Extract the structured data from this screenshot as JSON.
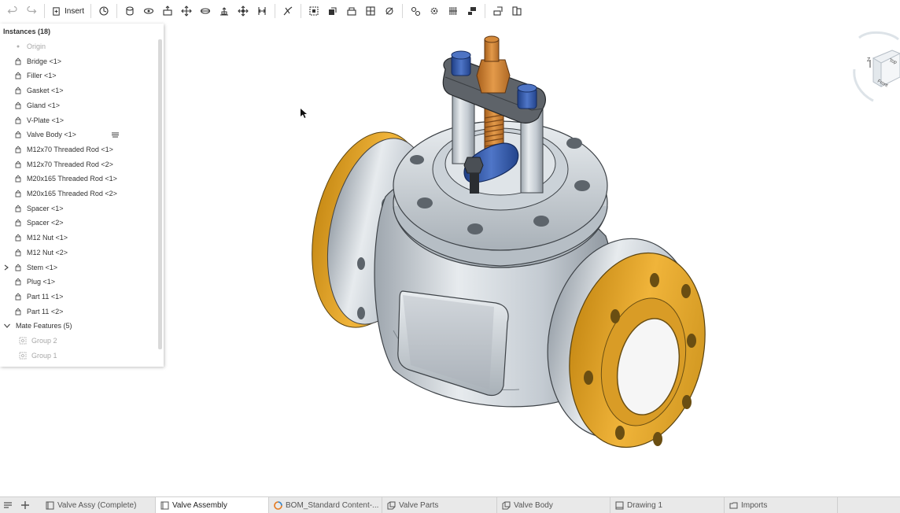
{
  "toolbar": {
    "insert_label": "Insert",
    "tools": [
      "undo-icon",
      "redo-icon",
      "insert-icon",
      "mate-connector-icon",
      "fastened-mate-icon",
      "revolute-mate-icon",
      "slider-mate-icon",
      "planar-mate-icon",
      "cylindrical-mate-icon",
      "pin-slot-mate-icon",
      "ball-mate-icon",
      "parallel-mate-icon",
      "tangent-mate-icon",
      "linear-pattern-icon",
      "circular-pattern-icon",
      "replicate-icon",
      "group-icon",
      "mate-connector-2-icon",
      "relations-icon",
      "gear-relation-icon",
      "rack-pinion-icon",
      "screw-relation-icon",
      "explode-icon",
      "display-states-icon"
    ]
  },
  "panel": {
    "title": "Instances (18)",
    "items": [
      {
        "label": "Origin",
        "type": "origin",
        "dim": true
      },
      {
        "label": "Bridge <1>",
        "type": "part"
      },
      {
        "label": "Filler <1>",
        "type": "part"
      },
      {
        "label": "Gasket <1>",
        "type": "part"
      },
      {
        "label": "Gland <1>",
        "type": "part"
      },
      {
        "label": "V-Plate <1>",
        "type": "part"
      },
      {
        "label": "Valve Body <1>",
        "type": "part"
      },
      {
        "label": "M12x70 Threaded Rod <1>",
        "type": "part"
      },
      {
        "label": "M12x70 Threaded Rod <2>",
        "type": "part"
      },
      {
        "label": "M20x165 Threaded Rod <1>",
        "type": "part"
      },
      {
        "label": "M20x165 Threaded Rod <2>",
        "type": "part"
      },
      {
        "label": "Spacer <1>",
        "type": "part"
      },
      {
        "label": "Spacer <2>",
        "type": "part"
      },
      {
        "label": "M12 Nut <1>",
        "type": "part"
      },
      {
        "label": "M12 Nut <2>",
        "type": "part"
      },
      {
        "label": "Stem <1>",
        "type": "part",
        "collapsed": true
      },
      {
        "label": "Plug <1>",
        "type": "part"
      },
      {
        "label": "Part 11 <1>",
        "type": "part"
      },
      {
        "label": "Part 11 <2>",
        "type": "part"
      },
      {
        "label": "Mate Features (5)",
        "type": "folder",
        "expanded": true
      },
      {
        "label": "Group 2",
        "type": "group",
        "dim": true
      },
      {
        "label": "Group 1",
        "type": "group",
        "dim": true
      }
    ]
  },
  "viewcube": {
    "top": "Top",
    "front": "Front",
    "axis_z": "Z"
  },
  "tabs": [
    {
      "label": "Valve Assy (Complete)",
      "icon": "assembly-icon",
      "active": false
    },
    {
      "label": "Valve Assembly",
      "icon": "assembly-icon",
      "active": true
    },
    {
      "label": "BOM_Standard Content-...",
      "icon": "bom-icon",
      "active": false
    },
    {
      "label": "Valve Parts",
      "icon": "part-studio-icon",
      "active": false
    },
    {
      "label": "Valve Body",
      "icon": "part-studio-icon",
      "active": false
    },
    {
      "label": "Drawing 1",
      "icon": "drawing-icon",
      "active": false
    },
    {
      "label": "Imports",
      "icon": "folder-icon",
      "active": false
    }
  ],
  "colors": {
    "gold": "#e4a52c",
    "steel": "#c9d1d9",
    "blue": "#2a4f9e",
    "bronze": "#c47a2c",
    "dark_steel": "#54585d"
  }
}
